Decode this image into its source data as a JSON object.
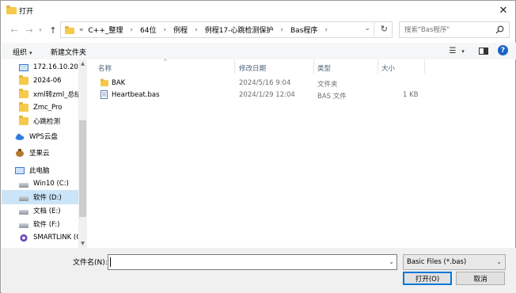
{
  "window": {
    "title": "打开"
  },
  "address": {
    "lead": "«",
    "crumbs": [
      "C++_整理",
      "64位",
      "例程",
      "例程17-心跳检测保护",
      "Bas程序"
    ]
  },
  "search": {
    "placeholder": "搜索\"Bas程序\""
  },
  "toolbar": {
    "organize": "组织",
    "new_folder": "新建文件夹"
  },
  "nav": {
    "items": [
      {
        "label": "172.16.10.20",
        "icon": "monitor-icon",
        "pinned": true
      },
      {
        "label": "2024-06",
        "icon": "folder-icon"
      },
      {
        "label": "xml转zml_总结",
        "icon": "folder-icon"
      },
      {
        "label": "Zmc_Pro",
        "icon": "folder-icon"
      },
      {
        "label": "心跳检测",
        "icon": "folder-icon"
      },
      {
        "label": "WPS云盘",
        "icon": "cloud-icon"
      },
      {
        "label": "坚果云",
        "icon": "nut-cloud-icon"
      },
      {
        "label": "此电脑",
        "icon": "computer-icon"
      },
      {
        "label": "Win10 (C:)",
        "icon": "drive-icon"
      },
      {
        "label": "软件 (D:)",
        "icon": "drive-icon",
        "selected": true
      },
      {
        "label": "文档 (E:)",
        "icon": "drive-icon"
      },
      {
        "label": "软件 (F:)",
        "icon": "drive-icon"
      },
      {
        "label": "SMARTLINK (G",
        "icon": "smartlink-icon"
      }
    ]
  },
  "columns": {
    "name": "名称",
    "date": "修改日期",
    "type": "类型",
    "size": "大小"
  },
  "files": [
    {
      "name": "BAK",
      "date": "2024/5/16 9:04",
      "type": "文件夹",
      "size": "",
      "icon": "folder-icon"
    },
    {
      "name": "Heartbeat.bas",
      "date": "2024/1/29 12:04",
      "type": "BAS 文件",
      "size": "1 KB",
      "icon": "bas-file-icon"
    }
  ],
  "bottom": {
    "filename_label": "文件名(N):",
    "filename_value": "",
    "filetype": "Basic Files (*.bas)",
    "open_label": "打开(O)",
    "cancel_label": "取消"
  },
  "colors": {
    "selected_bg": "#cce4f7",
    "accent": "#0078d7",
    "folder": "#f5c94a"
  }
}
